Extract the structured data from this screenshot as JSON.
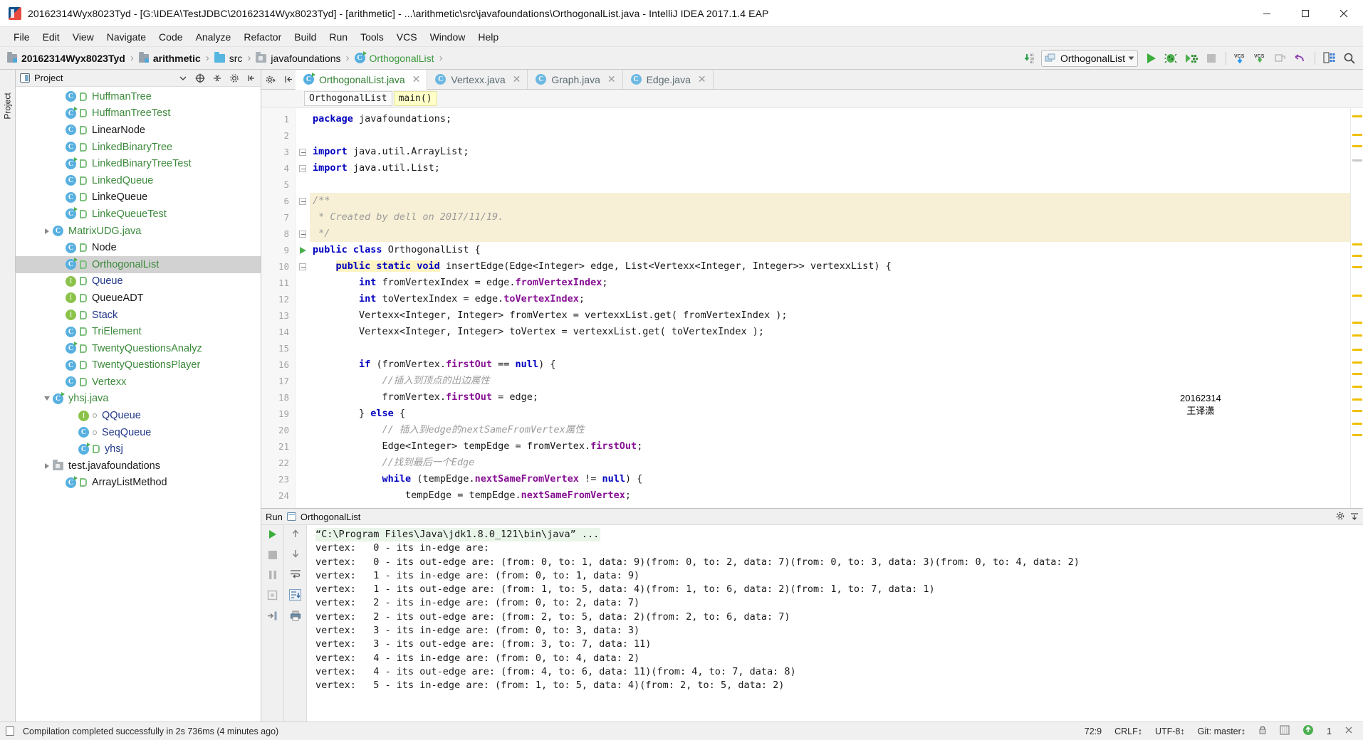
{
  "window": {
    "title": "20162314Wyx8023Tyd - [G:\\IDEA\\TestJDBC\\20162314Wyx8023Tyd] - [arithmetic] - ...\\arithmetic\\src\\javafoundations\\OrthogonalList.java - IntelliJ IDEA 2017.1.4 EAP",
    "minimize": "–",
    "maximize": "□",
    "close": "✕"
  },
  "menubar": {
    "items": [
      {
        "label": "File"
      },
      {
        "label": "Edit"
      },
      {
        "label": "View"
      },
      {
        "label": "Navigate"
      },
      {
        "label": "Code"
      },
      {
        "label": "Analyze"
      },
      {
        "label": "Refactor"
      },
      {
        "label": "Build"
      },
      {
        "label": "Run"
      },
      {
        "label": "Tools"
      },
      {
        "label": "VCS"
      },
      {
        "label": "Window"
      },
      {
        "label": "Help"
      }
    ]
  },
  "navbar": {
    "breadcrumbs": [
      {
        "label": "20162314Wyx8023Tyd",
        "icon": "module-icon",
        "style": "bold"
      },
      {
        "label": "arithmetic",
        "icon": "module-icon",
        "style": "bold"
      },
      {
        "label": "src",
        "icon": "source-folder-icon",
        "style": "plain"
      },
      {
        "label": "javafoundations",
        "icon": "package-icon",
        "style": "plain"
      },
      {
        "label": "OrthogonalList",
        "icon": "class-icon",
        "style": "green"
      }
    ],
    "separator": "›",
    "run_config": "OrthogonalList",
    "toolbar_icons": [
      "download-binary-icon",
      "run-icon",
      "debug-icon",
      "run-coverage-icon",
      "stop-icon",
      "vcs-update-icon",
      "vcs-commit-icon",
      "vcs-changes-icon",
      "undo-icon",
      "layout-icon",
      "search-everywhere-icon"
    ]
  },
  "project": {
    "panel_title": "Project",
    "tree": [
      {
        "label": "HuffmanTree",
        "icon": "class-icon",
        "indent": 3,
        "color": "green",
        "arrow": "none",
        "runnable": false,
        "bean": true
      },
      {
        "label": "HuffmanTreeTest",
        "icon": "class-icon",
        "indent": 3,
        "color": "green",
        "arrow": "none",
        "runnable": true,
        "bean": true
      },
      {
        "label": "LinearNode",
        "icon": "class-icon",
        "indent": 3,
        "color": "dark",
        "arrow": "none",
        "runnable": false,
        "bean": true
      },
      {
        "label": "LinkedBinaryTree",
        "icon": "class-icon",
        "indent": 3,
        "color": "green",
        "arrow": "none",
        "runnable": false,
        "bean": true
      },
      {
        "label": "LinkedBinaryTreeTest",
        "icon": "class-icon",
        "indent": 3,
        "color": "green",
        "arrow": "none",
        "runnable": true,
        "bean": true
      },
      {
        "label": "LinkedQueue",
        "icon": "class-icon",
        "indent": 3,
        "color": "green",
        "arrow": "none",
        "runnable": false,
        "bean": true
      },
      {
        "label": "LinkeQueue",
        "icon": "class-icon",
        "indent": 3,
        "color": "dark",
        "arrow": "none",
        "runnable": false,
        "bean": true
      },
      {
        "label": "LinkeQueueTest",
        "icon": "class-icon",
        "indent": 3,
        "color": "green",
        "arrow": "none",
        "runnable": true,
        "bean": true
      },
      {
        "label": "MatrixUDG.java",
        "icon": "class-icon",
        "indent": 2,
        "color": "green",
        "arrow": "collapsed",
        "runnable": false,
        "bean": false
      },
      {
        "label": "Node",
        "icon": "class-icon",
        "indent": 3,
        "color": "dark",
        "arrow": "none",
        "runnable": false,
        "bean": true
      },
      {
        "label": "OrthogonalList",
        "icon": "class-icon",
        "indent": 3,
        "color": "green",
        "arrow": "none",
        "runnable": true,
        "bean": true,
        "selected": true
      },
      {
        "label": "Queue",
        "icon": "interface-icon",
        "indent": 3,
        "color": "blue",
        "arrow": "none",
        "runnable": false,
        "bean": true
      },
      {
        "label": "QueueADT",
        "icon": "interface-icon",
        "indent": 3,
        "color": "dark",
        "arrow": "none",
        "runnable": false,
        "bean": true
      },
      {
        "label": "Stack",
        "icon": "interface-icon",
        "indent": 3,
        "color": "blue",
        "arrow": "none",
        "runnable": false,
        "bean": true
      },
      {
        "label": "TriElement",
        "icon": "class-icon",
        "indent": 3,
        "color": "green",
        "arrow": "none",
        "runnable": false,
        "bean": true
      },
      {
        "label": "TwentyQuestionsAnalyz",
        "icon": "class-icon",
        "indent": 3,
        "color": "green",
        "arrow": "none",
        "runnable": true,
        "bean": true
      },
      {
        "label": "TwentyQuestionsPlayer",
        "icon": "class-icon",
        "indent": 3,
        "color": "green",
        "arrow": "none",
        "runnable": false,
        "bean": true
      },
      {
        "label": "Vertexx",
        "icon": "class-icon",
        "indent": 3,
        "color": "green",
        "arrow": "none",
        "runnable": false,
        "bean": true
      },
      {
        "label": "yhsj.java",
        "icon": "class-icon",
        "indent": 2,
        "color": "green",
        "arrow": "expanded",
        "runnable": true,
        "bean": false
      },
      {
        "label": "QQueue",
        "icon": "interface-icon",
        "indent": 4,
        "color": "blue",
        "arrow": "none",
        "runnable": false,
        "bean": false,
        "small": true
      },
      {
        "label": "SeqQueue",
        "icon": "class-icon",
        "indent": 4,
        "color": "blue",
        "arrow": "none",
        "runnable": false,
        "bean": false,
        "small": true
      },
      {
        "label": "yhsj",
        "icon": "class-icon",
        "indent": 4,
        "color": "blue",
        "arrow": "none",
        "runnable": true,
        "bean": true
      },
      {
        "label": "test.javafoundations",
        "icon": "folder-icon",
        "indent": 2,
        "color": "dark",
        "arrow": "collapsed",
        "runnable": false,
        "bean": false
      },
      {
        "label": "ArrayListMethod",
        "icon": "class-icon",
        "indent": 3,
        "color": "dark",
        "arrow": "none",
        "runnable": true,
        "bean": true
      }
    ]
  },
  "editor": {
    "tabs": [
      {
        "label": "OrthogonalList.java",
        "active": true,
        "close": "✕"
      },
      {
        "label": "Vertexx.java",
        "active": false,
        "close": "✕"
      },
      {
        "label": "Graph.java",
        "active": false,
        "close": "✕"
      },
      {
        "label": "Edge.java",
        "active": false,
        "close": "✕"
      }
    ],
    "breadcrumb_chips": [
      {
        "label": "OrthogonalList",
        "highlighted": false
      },
      {
        "label": "main()",
        "highlighted": true
      }
    ],
    "lines": [
      {
        "n": 1,
        "html": "<span class=\"kw\">package</span> <span class=\"plain\">javafoundations;</span>"
      },
      {
        "n": 2,
        "html": ""
      },
      {
        "n": 3,
        "html": "<span class=\"kw\">import</span> <span class=\"plain\">java.util.ArrayList;</span>"
      },
      {
        "n": 4,
        "html": "<span class=\"kw\">import</span> <span class=\"plain\">java.util.List;</span>"
      },
      {
        "n": 5,
        "html": ""
      },
      {
        "n": 6,
        "html": "<span class=\"cmt\">/**</span>",
        "hl": true
      },
      {
        "n": 7,
        "html": "<span class=\"cmt\"> * Created by dell on 2017/11/19.</span>",
        "hl": true
      },
      {
        "n": 8,
        "html": "<span class=\"cmt\"> */</span>",
        "hl": true
      },
      {
        "n": 9,
        "html": "<span class=\"kw\">public class</span> <span class=\"plain\">OrthogonalList {</span>"
      },
      {
        "n": 10,
        "html": "    <span class=\"kw hlw\">public static void</span> <span class=\"plain\">insertEdge(Edge&lt;Integer&gt; edge, List&lt;Vertexx&lt;Integer, Integer&gt;&gt; vertexxList) {</span>"
      },
      {
        "n": 11,
        "html": "        <span class=\"kw\">int</span> <span class=\"plain\">fromVertexIndex = edge.</span><span class=\"fld\">fromVertexIndex</span><span class=\"plain\">;</span>"
      },
      {
        "n": 12,
        "html": "        <span class=\"kw\">int</span> <span class=\"plain\">toVertexIndex = edge.</span><span class=\"fld\">toVertexIndex</span><span class=\"plain\">;</span>"
      },
      {
        "n": 13,
        "html": "        <span class=\"plain\">Vertexx&lt;Integer, Integer&gt; fromVertex = vertexxList.get( fromVertexIndex );</span>"
      },
      {
        "n": 14,
        "html": "        <span class=\"plain\">Vertexx&lt;Integer, Integer&gt; toVertex = vertexxList.get( toVertexIndex );</span>"
      },
      {
        "n": 15,
        "html": ""
      },
      {
        "n": 16,
        "html": "        <span class=\"kw\">if</span> <span class=\"plain\">(fromVertex.</span><span class=\"fld\">firstOut</span> <span class=\"plain\">== </span><span class=\"kw\">null</span><span class=\"plain\">) {</span>"
      },
      {
        "n": 17,
        "html": "            <span class=\"cmt\">//插入到顶点的出边属性</span>"
      },
      {
        "n": 18,
        "html": "            <span class=\"plain\">fromVertex.</span><span class=\"fld\">firstOut</span> <span class=\"plain\">= edge;</span>"
      },
      {
        "n": 19,
        "html": "        <span class=\"plain\">} </span><span class=\"kw\">else</span> <span class=\"plain\">{</span>"
      },
      {
        "n": 20,
        "html": "            <span class=\"cmt\">// 插入到edge的nextSameFromVertex属性</span>"
      },
      {
        "n": 21,
        "html": "            <span class=\"plain\">Edge&lt;Integer&gt; tempEdge = fromVertex.</span><span class=\"fld\">firstOut</span><span class=\"plain\">;</span>"
      },
      {
        "n": 22,
        "html": "            <span class=\"cmt\">//找到最后一个Edge</span>"
      },
      {
        "n": 23,
        "html": "            <span class=\"kw\">while</span> <span class=\"plain\">(tempEdge.</span><span class=\"fld\">nextSameFromVertex</span> <span class=\"plain\">!= </span><span class=\"kw\">null</span><span class=\"plain\">) {</span>"
      },
      {
        "n": 24,
        "html": "                <span class=\"plain\">tempEdge = tempEdge.</span><span class=\"fld\">nextSameFromVertex</span><span class=\"plain\">;</span>"
      }
    ],
    "watermark_line1": "20162314",
    "watermark_line2": "王译潇"
  },
  "run": {
    "tab_title": "Run",
    "config_name": "OrthogonalList",
    "console_lines": [
      {
        "text": "“C:\\Program Files\\Java\\jdk1.8.0_121\\bin\\java” ...",
        "first": true
      },
      {
        "text": "vertex:   0 - its in-edge are:"
      },
      {
        "text": "vertex:   0 - its out-edge are: (from: 0, to: 1, data: 9)(from: 0, to: 2, data: 7)(from: 0, to: 3, data: 3)(from: 0, to: 4, data: 2)"
      },
      {
        "text": "vertex:   1 - its in-edge are: (from: 0, to: 1, data: 9)"
      },
      {
        "text": "vertex:   1 - its out-edge are: (from: 1, to: 5, data: 4)(from: 1, to: 6, data: 2)(from: 1, to: 7, data: 1)"
      },
      {
        "text": "vertex:   2 - its in-edge are: (from: 0, to: 2, data: 7)"
      },
      {
        "text": "vertex:   2 - its out-edge are: (from: 2, to: 5, data: 2)(from: 2, to: 6, data: 7)"
      },
      {
        "text": "vertex:   3 - its in-edge are: (from: 0, to: 3, data: 3)"
      },
      {
        "text": "vertex:   3 - its out-edge are: (from: 3, to: 7, data: 11)"
      },
      {
        "text": "vertex:   4 - its in-edge are: (from: 0, to: 4, data: 2)"
      },
      {
        "text": "vertex:   4 - its out-edge are: (from: 4, to: 6, data: 11)(from: 4, to: 7, data: 8)"
      },
      {
        "text": "vertex:   5 - its in-edge are: (from: 1, to: 5, data: 4)(from: 2, to: 5, data: 2)"
      }
    ]
  },
  "statusbar": {
    "message": "Compilation completed successfully in 2s 736ms (4 minutes ago)",
    "caret": "72:9",
    "line_sep": "CRLF↕",
    "encoding": "UTF-8↕",
    "branch": "Git: master↕",
    "lock": "lock-icon",
    "count": "1"
  }
}
